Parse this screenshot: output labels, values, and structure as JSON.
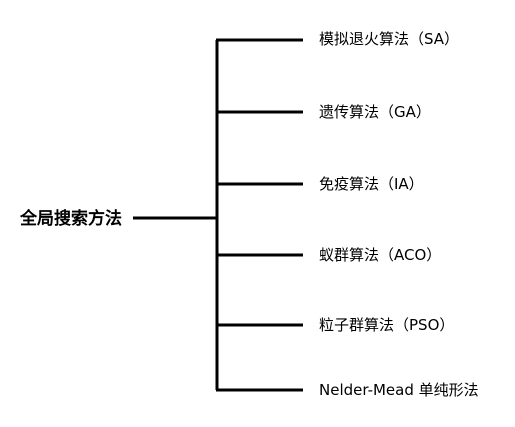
{
  "diagram": {
    "root": "全局搜索方法",
    "leaves": [
      "模拟退火算法（SA）",
      "遗传算法（GA）",
      "免疫算法（IA）",
      "蚁群算法（ACO）",
      "粒子群算法（PSO）",
      "Nelder-Mead 单纯形法"
    ]
  },
  "colors": {
    "line": "#000000",
    "text": "#000000",
    "background": "#ffffff"
  }
}
